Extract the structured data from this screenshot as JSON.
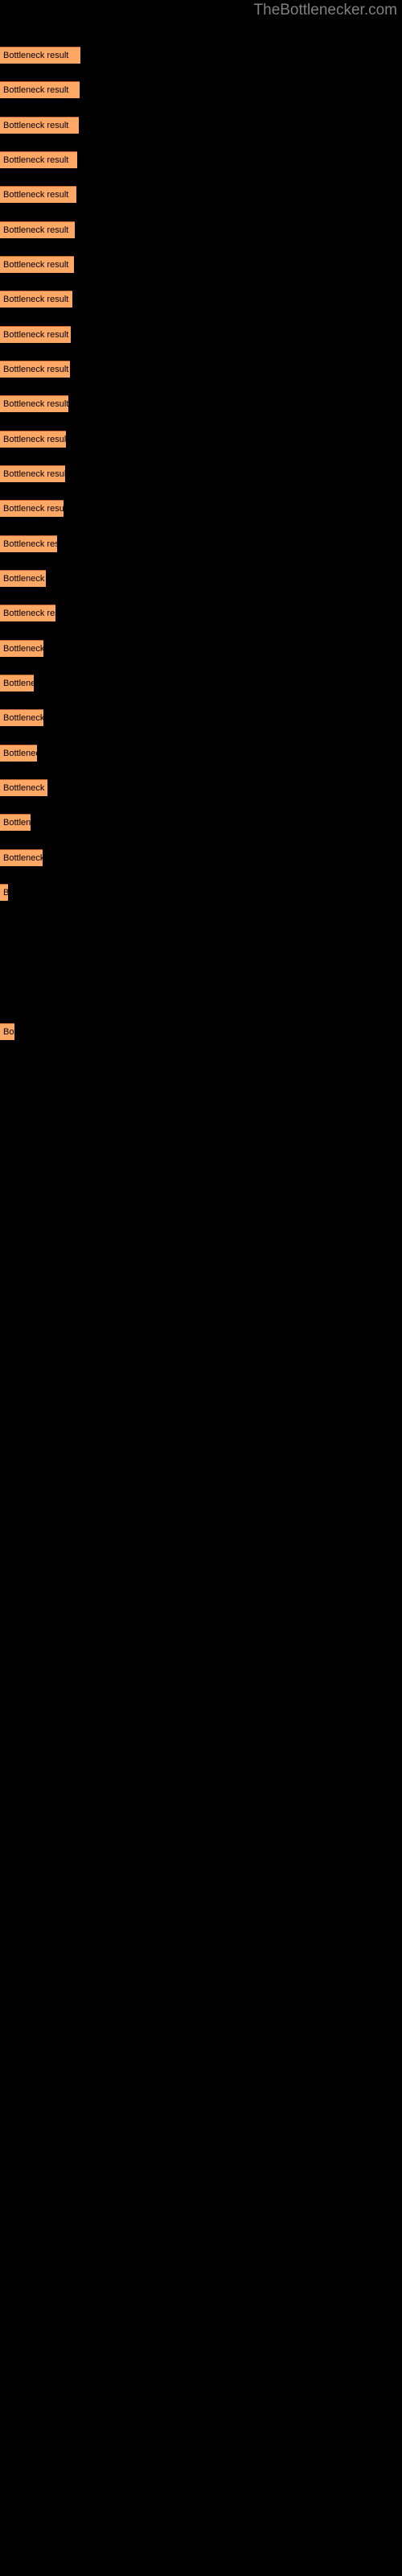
{
  "site": {
    "title": "TheBottlenecker.com",
    "title_color": "#808080"
  },
  "theme": {
    "background": "#000000",
    "bar_fill": "#ffa866",
    "bar_border_top": "#c86a33",
    "bar_text": "#000000"
  },
  "chart_data": {
    "type": "bar",
    "orientation": "horizontal",
    "title": "TheBottlenecker.com",
    "xlabel": "",
    "ylabel": "",
    "grid": false,
    "legend": null,
    "bar_label_text": "Bottleneck result",
    "categories": [
      "Bottleneck result",
      "Bottleneck result",
      "Bottleneck result",
      "Bottleneck result",
      "Bottleneck result",
      "Bottleneck result",
      "Bottleneck result",
      "Bottleneck result",
      "Bottleneck result",
      "Bottleneck result",
      "Bottleneck result",
      "Bottleneck result",
      "Bottleneck result",
      "Bottleneck result",
      "Bottleneck result",
      "Bottleneck result",
      "Bottleneck result",
      "Bottleneck result",
      "Bottleneck result",
      "Bottleneck result",
      "Bottleneck result",
      "Bottleneck result",
      "Bottleneck result",
      "Bottleneck result",
      "Bottleneck result",
      "Bottleneck result"
    ],
    "values": [
      100,
      99,
      98,
      96,
      95,
      93,
      92,
      90,
      88,
      87,
      85,
      82,
      81,
      79,
      71,
      57,
      69,
      54,
      42,
      54,
      46,
      59,
      38,
      53,
      10,
      18
    ],
    "xlim": [
      0,
      500
    ],
    "bar_tops": [
      58,
      101,
      144,
      188,
      231,
      274,
      318,
      361,
      404,
      448,
      491,
      534,
      578,
      621,
      664,
      708,
      751,
      794,
      838,
      881,
      924,
      968,
      1011,
      1054,
      1098,
      1141
    ]
  },
  "bars": [
    {
      "label": "Bottleneck result",
      "width": 100,
      "top": 58
    },
    {
      "label": "Bottleneck result",
      "width": 99,
      "top": 101
    },
    {
      "label": "Bottleneck result",
      "width": 98,
      "top": 145
    },
    {
      "label": "Bottleneck result",
      "width": 96,
      "top": 188
    },
    {
      "label": "Bottleneck result",
      "width": 95,
      "top": 231
    },
    {
      "label": "Bottleneck result",
      "width": 93,
      "top": 275
    },
    {
      "label": "Bottleneck result",
      "width": 92,
      "top": 318
    },
    {
      "label": "Bottleneck result",
      "width": 90,
      "top": 361
    },
    {
      "label": "Bottleneck result",
      "width": 88,
      "top": 405
    },
    {
      "label": "Bottleneck result",
      "width": 87,
      "top": 448
    },
    {
      "label": "Bottleneck result",
      "width": 85,
      "top": 491
    },
    {
      "label": "Bottleneck result",
      "width": 82,
      "top": 535
    },
    {
      "label": "Bottleneck result",
      "width": 81,
      "top": 578
    },
    {
      "label": "Bottleneck result",
      "width": 79,
      "top": 621
    },
    {
      "label": "Bottleneck result",
      "width": 71,
      "top": 665
    },
    {
      "label": "Bottleneck result",
      "width": 57,
      "top": 708
    },
    {
      "label": "Bottleneck result",
      "width": 69,
      "top": 751
    },
    {
      "label": "Bottleneck result",
      "width": 54,
      "top": 795
    },
    {
      "label": "Bottleneck result",
      "width": 42,
      "top": 838
    },
    {
      "label": "Bottleneck result",
      "width": 54,
      "top": 881
    },
    {
      "label": "Bottleneck result",
      "width": 46,
      "top": 925
    },
    {
      "label": "Bottleneck result",
      "width": 59,
      "top": 968
    },
    {
      "label": "Bottleneck result",
      "width": 38,
      "top": 1011
    },
    {
      "label": "Bottleneck result",
      "width": 53,
      "top": 1055
    },
    {
      "label": "Bottleneck result",
      "width": 10,
      "top": 1098
    },
    {
      "label": "Bottleneck result",
      "width": 18,
      "top": 1271
    }
  ]
}
